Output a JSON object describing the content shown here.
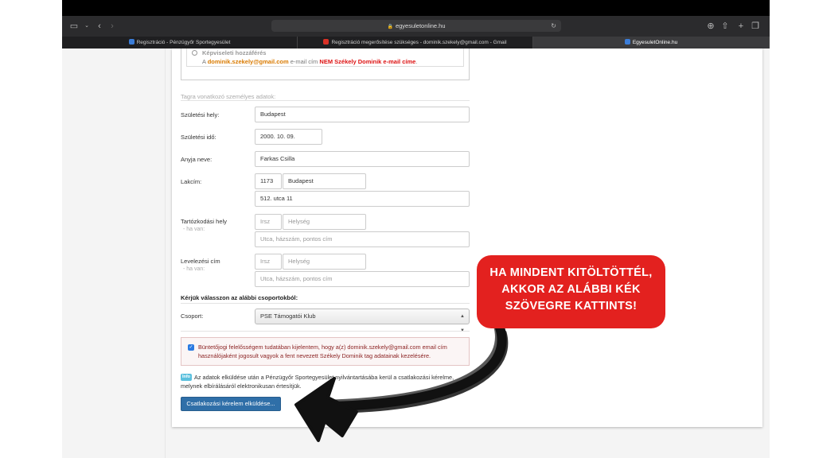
{
  "browser": {
    "url": "egyesuletonline.hu",
    "tabs": [
      {
        "label": "Regisztráció - Pénzügyőr Sportegyesület",
        "color": "#3b7dd8"
      },
      {
        "label": "Regisztráció megerősítése szükséges - dominik.szekely@gmail.com - Gmail",
        "color": "#d93025"
      },
      {
        "label": "EgyesuletOnline.hu",
        "color": "#3b7dd8"
      }
    ]
  },
  "representation": {
    "title": "Képviseleti hozzáférés",
    "prefix": "A",
    "email": "dominik.szekely@gmail.com",
    "middle": "e-mail cím",
    "negation": "NEM Székely Dominik e-mail címe",
    "suffix": "."
  },
  "form": {
    "section_title": "Tagra vonatkozó személyes adatok:",
    "birth_place_label": "Születési hely:",
    "birth_place_value": "Budapest",
    "birth_date_label": "Születési idő:",
    "birth_date_value": "2000. 10. 09.",
    "mother_name_label": "Anyja neve:",
    "mother_name_value": "Farkas Csilla",
    "address_label": "Lakcím:",
    "address_zip": "1173",
    "address_city": "Budapest",
    "address_street": "512. utca 11",
    "temp_label": "Tartózkodási hely",
    "temp_sublabel": "- ha van:",
    "mail_label": "Levelezési cím",
    "mail_sublabel": "- ha van:",
    "zip_placeholder": "Irsz",
    "city_placeholder": "Helység",
    "street_placeholder": "Utca, házszám, pontos cím",
    "group_prompt": "Kérjük válasszon az alábbi csoportokból:",
    "group_label": "Csoport:",
    "group_value": "PSE Támogatói Klub",
    "consent_text": "Büntetőjogi felelősségem tudatában kijelentem, hogy a(z) dominik.szekely@gmail.com email cím használójaként jogosult vagyok a fent nevezett Székely Dominik tag adatainak kezelésére.",
    "info_badge": "Info",
    "info_text": "Az adatok elküldése után a Pénzügyőr Sportegyesület nyilvántartásába kerül a csatlakozási kérelme, melynek elbírálásáról elektronikusan értesítjük.",
    "submit_label": "Csatlakozási kérelem elküldése..."
  },
  "callout": {
    "line1": "HA MINDENT KITÖLTÖTTÉL,",
    "line2": "AKKOR AZ ALÁBBI KÉK",
    "line3": "SZÖVEGRE KATTINTS!",
    "color": "#e3211f"
  }
}
